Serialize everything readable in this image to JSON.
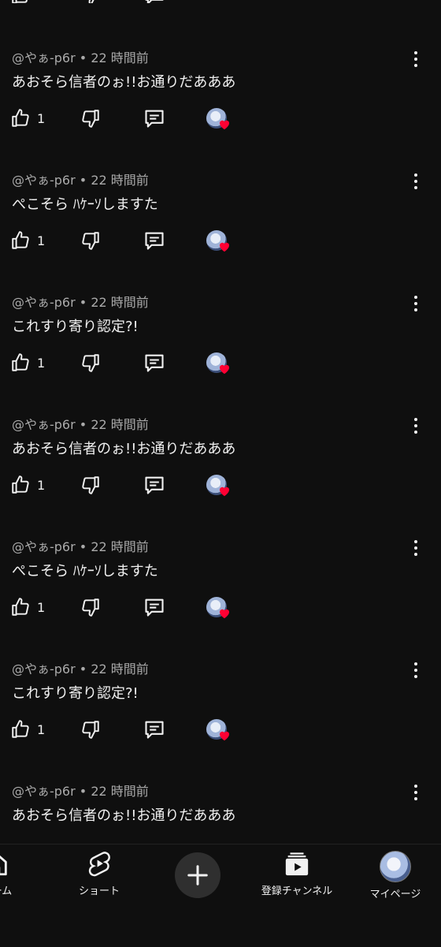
{
  "comments": [
    {
      "author": "@やぁ-p6r",
      "time": "22 時間前",
      "text": "あおそら信者のぉ!!お通りだあああ",
      "likes": "1"
    },
    {
      "author": "@やぁ-p6r",
      "time": "22 時間前",
      "text": "ぺこそら ﾊｹｰｿしますた",
      "likes": "1"
    },
    {
      "author": "@やぁ-p6r",
      "time": "22 時間前",
      "text": "これすり寄り認定?!",
      "likes": "1"
    },
    {
      "author": "@やぁ-p6r",
      "time": "22 時間前",
      "text": "あおそら信者のぉ!!お通りだあああ",
      "likes": "1"
    },
    {
      "author": "@やぁ-p6r",
      "time": "22 時間前",
      "text": "ぺこそら ﾊｹｰｿしますた",
      "likes": "1"
    },
    {
      "author": "@やぁ-p6r",
      "time": "22 時間前",
      "text": "これすり寄り認定?!",
      "likes": "1"
    },
    {
      "author": "@やぁ-p6r",
      "time": "22 時間前",
      "text": "あおそら信者のぉ!!お通りだあああ",
      "likes": ""
    }
  ],
  "separator": " • ",
  "nav": {
    "home_label": "ホーム",
    "shorts_label": "ショート",
    "subscriptions_label": "登録チャンネル",
    "you_label": "マイページ"
  },
  "colors": {
    "background": "#0f0f0f",
    "meta_text": "#aaaaaa",
    "heart": "#ff0033"
  },
  "icons": [
    "thumb-up-icon",
    "thumb-down-icon",
    "reply-icon",
    "heart-icon",
    "more-vert-icon",
    "home-icon",
    "shorts-icon",
    "add-icon",
    "subscriptions-icon"
  ]
}
